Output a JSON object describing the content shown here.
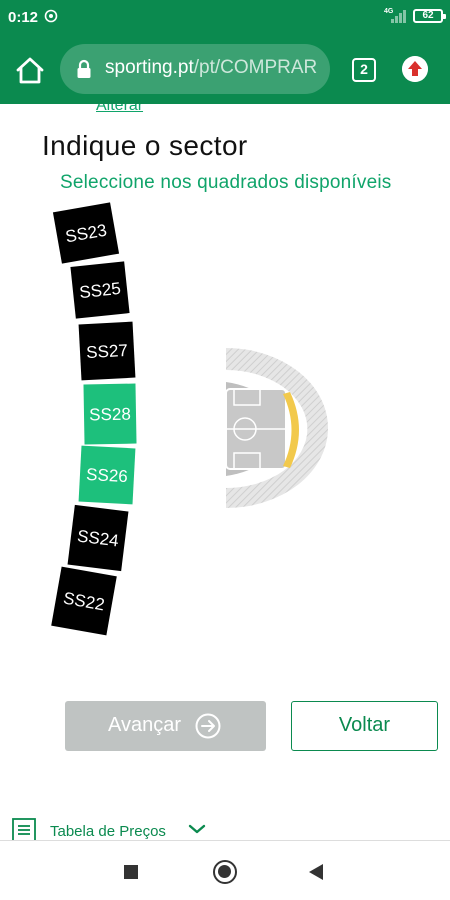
{
  "status_bar": {
    "time": "0:12",
    "network": "4G",
    "battery": "62"
  },
  "browser": {
    "url_domain": "sporting.pt",
    "url_path": "/pt/COMPRAR",
    "tab_count": "2"
  },
  "content": {
    "change_link": "Alterar",
    "title": "Indique o sector",
    "subtitle": "Seleccione nos quadrados disponíveis"
  },
  "sectors": [
    {
      "label": "SS23",
      "status": "unavailable"
    },
    {
      "label": "SS25",
      "status": "unavailable"
    },
    {
      "label": "SS27",
      "status": "unavailable"
    },
    {
      "label": "SS28",
      "status": "available"
    },
    {
      "label": "SS26",
      "status": "available"
    },
    {
      "label": "SS24",
      "status": "unavailable"
    },
    {
      "label": "SS22",
      "status": "unavailable"
    }
  ],
  "buttons": {
    "advance": "Avançar",
    "back": "Voltar"
  },
  "price_table": {
    "label": "Tabela de Preços"
  },
  "colors": {
    "brand": "#0b8a4f",
    "accent": "#10a46a",
    "available": "#1dc07c",
    "unavailable": "#000000",
    "selected_zone": "#f2c94c",
    "disabled": "#bfc3c2"
  }
}
